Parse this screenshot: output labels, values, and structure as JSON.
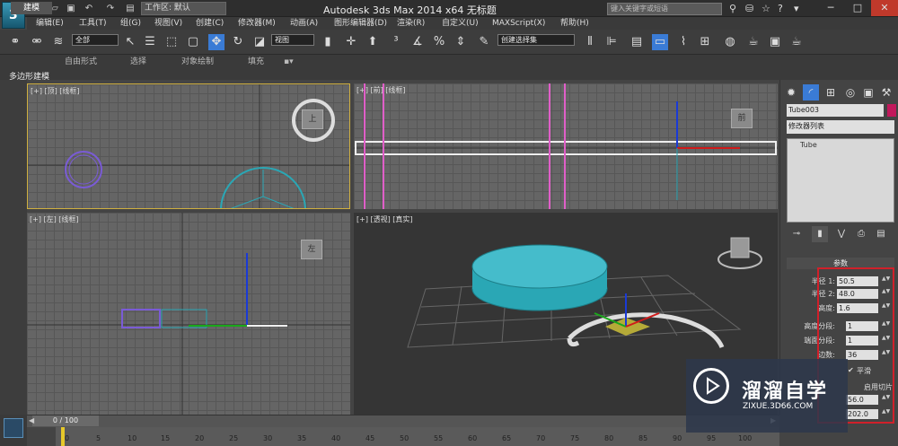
{
  "window": {
    "title": "Autodesk 3ds Max  2014 x64     无标题",
    "workspace": "工作区: 默认",
    "search_placeholder": "键入关键字或短语"
  },
  "menu": [
    "编辑(E)",
    "工具(T)",
    "组(G)",
    "视图(V)",
    "创建(C)",
    "修改器(M)",
    "动画(A)",
    "图形编辑器(D)",
    "渲染(R)",
    "自定义(U)",
    "MAXScript(X)",
    "帮助(H)"
  ],
  "toolbar": {
    "filter": "全部",
    "ref_coord": "视图",
    "named_sel": "创建选择集"
  },
  "ribbon": {
    "tabs": [
      "建模",
      "自由形式",
      "选择",
      "对象绘制",
      "填充"
    ],
    "sub": "多边形建模"
  },
  "viewports": {
    "top": "[+] [顶] [线框]",
    "front": "[+] [前] [线框]",
    "left": "[+] [左] [线框]",
    "persp": "[+] [透视] [真实]"
  },
  "cube": {
    "top": "上",
    "front": "前",
    "left": "左"
  },
  "panel": {
    "object_name": "Tube003",
    "modifier_list": "修改器列表",
    "stack_item": "Tube",
    "rollout": "参数"
  },
  "params": [
    {
      "label": "半径 1:",
      "value": "50.5"
    },
    {
      "label": "半径 2:",
      "value": "48.0"
    },
    {
      "label": "高度:",
      "value": "1.6"
    },
    {
      "label": "高度分段:",
      "value": "1"
    },
    {
      "label": "端面分段:",
      "value": "1"
    },
    {
      "label": "边数:",
      "value": "36"
    }
  ],
  "smooth": "平滑",
  "slice": "启用切片",
  "slice_from": "56.0",
  "slice_to": "202.0",
  "timeline": {
    "frame": "0 / 100",
    "ticks": [
      "0",
      "5",
      "10",
      "15",
      "20",
      "25",
      "30",
      "35",
      "40",
      "45",
      "50",
      "55",
      "60",
      "65",
      "70",
      "75",
      "80",
      "85",
      "90",
      "95",
      "100"
    ]
  },
  "watermark": {
    "title": "溜溜自学",
    "url": "ZIXUE.3D66.COM"
  },
  "colors": {
    "accent": "#4fa8c8",
    "teal": "#2aa7b5",
    "selection_red": "#d0202a"
  }
}
